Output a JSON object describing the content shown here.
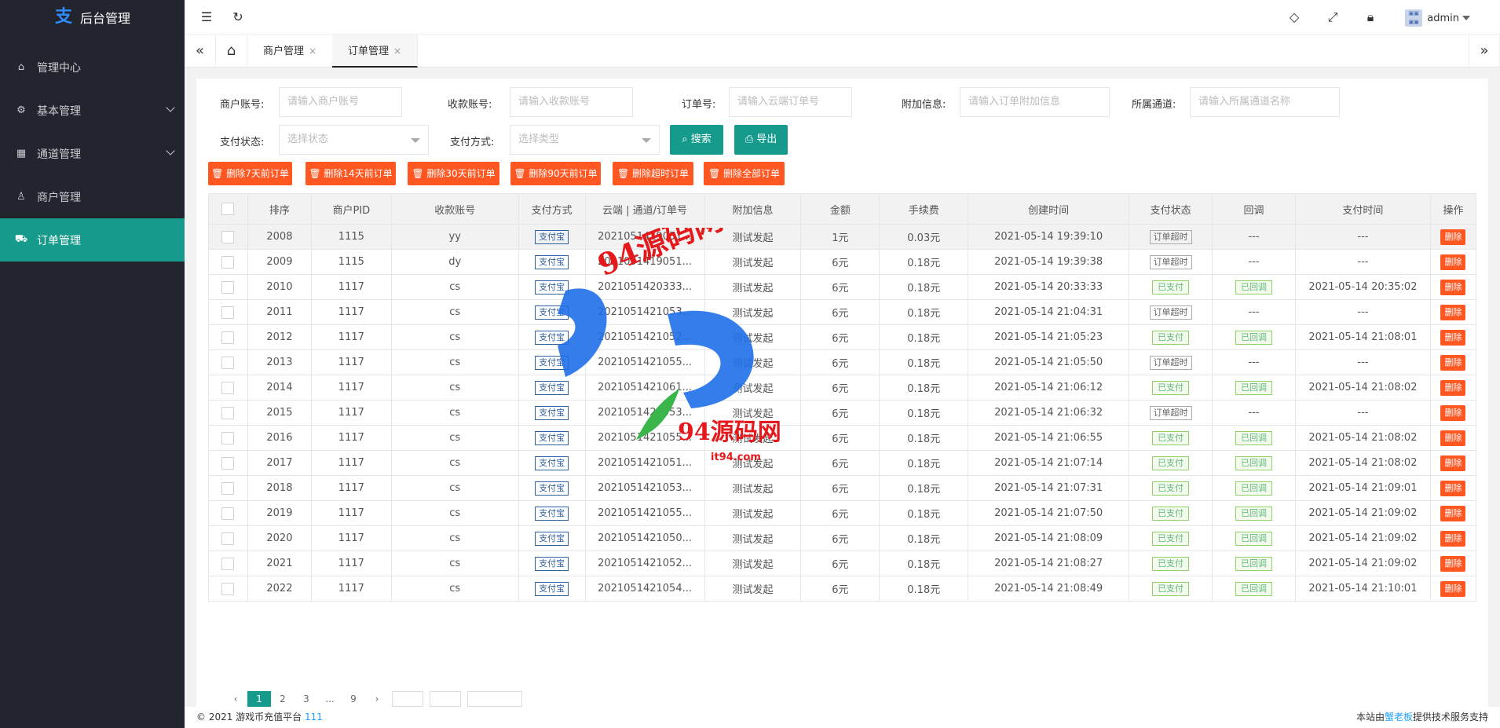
{
  "app": {
    "title": "后台管理"
  },
  "sidebar": {
    "items": [
      {
        "label": "管理中心",
        "icon": "home-icon"
      },
      {
        "label": "基本管理",
        "icon": "gear-icon"
      },
      {
        "label": "通道管理",
        "icon": "grid-icon"
      },
      {
        "label": "商户管理",
        "icon": "user-icon"
      },
      {
        "label": "订单管理",
        "icon": "cart-icon"
      }
    ]
  },
  "header": {
    "user": "admin"
  },
  "tabs": [
    {
      "label": "商户管理"
    },
    {
      "label": "订单管理"
    }
  ],
  "filters": {
    "merchant_label": "商户账号:",
    "merchant_placeholder": "请输入商户账号",
    "account_label": "收款账号:",
    "account_placeholder": "请输入收款账号",
    "order_label": "订单号:",
    "order_placeholder": "请输入云端订单号",
    "extra_label": "附加信息:",
    "extra_placeholder": "请输入订单附加信息",
    "channel_label": "所属通道:",
    "channel_placeholder": "请输入所属通道名称",
    "status_label": "支付状态:",
    "status_placeholder": "选择状态",
    "method_label": "支付方式:",
    "method_placeholder": "选择类型",
    "search_label": "搜索",
    "export_label": "导出"
  },
  "delete_buttons": [
    "删除7天前订单",
    "删除14天前订单",
    "删除30天前订单",
    "删除90天前订单",
    "删除超时订单",
    "删除全部订单"
  ],
  "table": {
    "headers": [
      "排序",
      "商户PID",
      "收款账号",
      "支付方式",
      "云端 | 通道/订单号",
      "附加信息",
      "金额",
      "手续费",
      "创建时间",
      "支付状态",
      "回调",
      "支付时间",
      "操作"
    ],
    "pay_label": "支付宝",
    "delete_label": "删除",
    "rows": [
      {
        "id": "2008",
        "pid": "1115",
        "acct": "yy",
        "order": "2021051419051...",
        "extra": "测试发起",
        "amount": "1元",
        "fee": "0.03元",
        "created": "2021-05-14 19:39:10",
        "status": "订单超时",
        "paid": false,
        "callback": "---",
        "paytime": "---"
      },
      {
        "id": "2009",
        "pid": "1115",
        "acct": "dy",
        "order": "2021051419051...",
        "extra": "测试发起",
        "amount": "6元",
        "fee": "0.18元",
        "created": "2021-05-14 19:39:38",
        "status": "订单超时",
        "paid": false,
        "callback": "---",
        "paytime": "---"
      },
      {
        "id": "2010",
        "pid": "1117",
        "acct": "cs",
        "order": "2021051420333...",
        "extra": "测试发起",
        "amount": "6元",
        "fee": "0.18元",
        "created": "2021-05-14 20:33:33",
        "status": "已支付",
        "paid": true,
        "callback": "已回调",
        "paytime": "2021-05-14 20:35:02"
      },
      {
        "id": "2011",
        "pid": "1117",
        "acct": "cs",
        "order": "2021051421053...",
        "extra": "测试发起",
        "amount": "6元",
        "fee": "0.18元",
        "created": "2021-05-14 21:04:31",
        "status": "订单超时",
        "paid": false,
        "callback": "---",
        "paytime": "---"
      },
      {
        "id": "2012",
        "pid": "1117",
        "acct": "cs",
        "order": "2021051421052...",
        "extra": "测试发起",
        "amount": "6元",
        "fee": "0.18元",
        "created": "2021-05-14 21:05:23",
        "status": "已支付",
        "paid": true,
        "callback": "已回调",
        "paytime": "2021-05-14 21:08:01"
      },
      {
        "id": "2013",
        "pid": "1117",
        "acct": "cs",
        "order": "2021051421055...",
        "extra": "测试发起",
        "amount": "6元",
        "fee": "0.18元",
        "created": "2021-05-14 21:05:50",
        "status": "订单超时",
        "paid": false,
        "callback": "---",
        "paytime": "---"
      },
      {
        "id": "2014",
        "pid": "1117",
        "acct": "cs",
        "order": "2021051421061...",
        "extra": "测试发起",
        "amount": "6元",
        "fee": "0.18元",
        "created": "2021-05-14 21:06:12",
        "status": "已支付",
        "paid": true,
        "callback": "已回调",
        "paytime": "2021-05-14 21:08:02"
      },
      {
        "id": "2015",
        "pid": "1117",
        "acct": "cs",
        "order": "2021051421053...",
        "extra": "测试发起",
        "amount": "6元",
        "fee": "0.18元",
        "created": "2021-05-14 21:06:32",
        "status": "订单超时",
        "paid": false,
        "callback": "---",
        "paytime": "---"
      },
      {
        "id": "2016",
        "pid": "1117",
        "acct": "cs",
        "order": "2021051421055...",
        "extra": "测试发起",
        "amount": "6元",
        "fee": "0.18元",
        "created": "2021-05-14 21:06:55",
        "status": "已支付",
        "paid": true,
        "callback": "已回调",
        "paytime": "2021-05-14 21:08:02"
      },
      {
        "id": "2017",
        "pid": "1117",
        "acct": "cs",
        "order": "2021051421051...",
        "extra": "测试发起",
        "amount": "6元",
        "fee": "0.18元",
        "created": "2021-05-14 21:07:14",
        "status": "已支付",
        "paid": true,
        "callback": "已回调",
        "paytime": "2021-05-14 21:08:02"
      },
      {
        "id": "2018",
        "pid": "1117",
        "acct": "cs",
        "order": "2021051421053...",
        "extra": "测试发起",
        "amount": "6元",
        "fee": "0.18元",
        "created": "2021-05-14 21:07:31",
        "status": "已支付",
        "paid": true,
        "callback": "已回调",
        "paytime": "2021-05-14 21:09:01"
      },
      {
        "id": "2019",
        "pid": "1117",
        "acct": "cs",
        "order": "2021051421055...",
        "extra": "测试发起",
        "amount": "6元",
        "fee": "0.18元",
        "created": "2021-05-14 21:07:50",
        "status": "已支付",
        "paid": true,
        "callback": "已回调",
        "paytime": "2021-05-14 21:09:02"
      },
      {
        "id": "2020",
        "pid": "1117",
        "acct": "cs",
        "order": "2021051421050...",
        "extra": "测试发起",
        "amount": "6元",
        "fee": "0.18元",
        "created": "2021-05-14 21:08:09",
        "status": "已支付",
        "paid": true,
        "callback": "已回调",
        "paytime": "2021-05-14 21:09:02"
      },
      {
        "id": "2021",
        "pid": "1117",
        "acct": "cs",
        "order": "2021051421052...",
        "extra": "测试发起",
        "amount": "6元",
        "fee": "0.18元",
        "created": "2021-05-14 21:08:27",
        "status": "已支付",
        "paid": true,
        "callback": "已回调",
        "paytime": "2021-05-14 21:09:02"
      },
      {
        "id": "2022",
        "pid": "1117",
        "acct": "cs",
        "order": "2021051421054...",
        "extra": "测试发起",
        "amount": "6元",
        "fee": "0.18元",
        "created": "2021-05-14 21:08:49",
        "status": "已支付",
        "paid": true,
        "callback": "已回调",
        "paytime": "2021-05-14 21:10:01"
      }
    ]
  },
  "pager": {
    "pages": [
      "1",
      "2",
      "3",
      "...",
      "9"
    ],
    "current": "1"
  },
  "footer": {
    "left": "© 2021 游戏币充值平台",
    "left_link": "111",
    "right_prefix": "本站由",
    "right_link": "蟹老板",
    "right_suffix": "提供技术服务支持"
  },
  "watermark": {
    "text1": "94源码网",
    "text2": "94源码网",
    "url": "it94.com"
  },
  "colors": {
    "accent": "#159a8c",
    "danger": "#ff5722",
    "sidebar": "#22242e"
  }
}
